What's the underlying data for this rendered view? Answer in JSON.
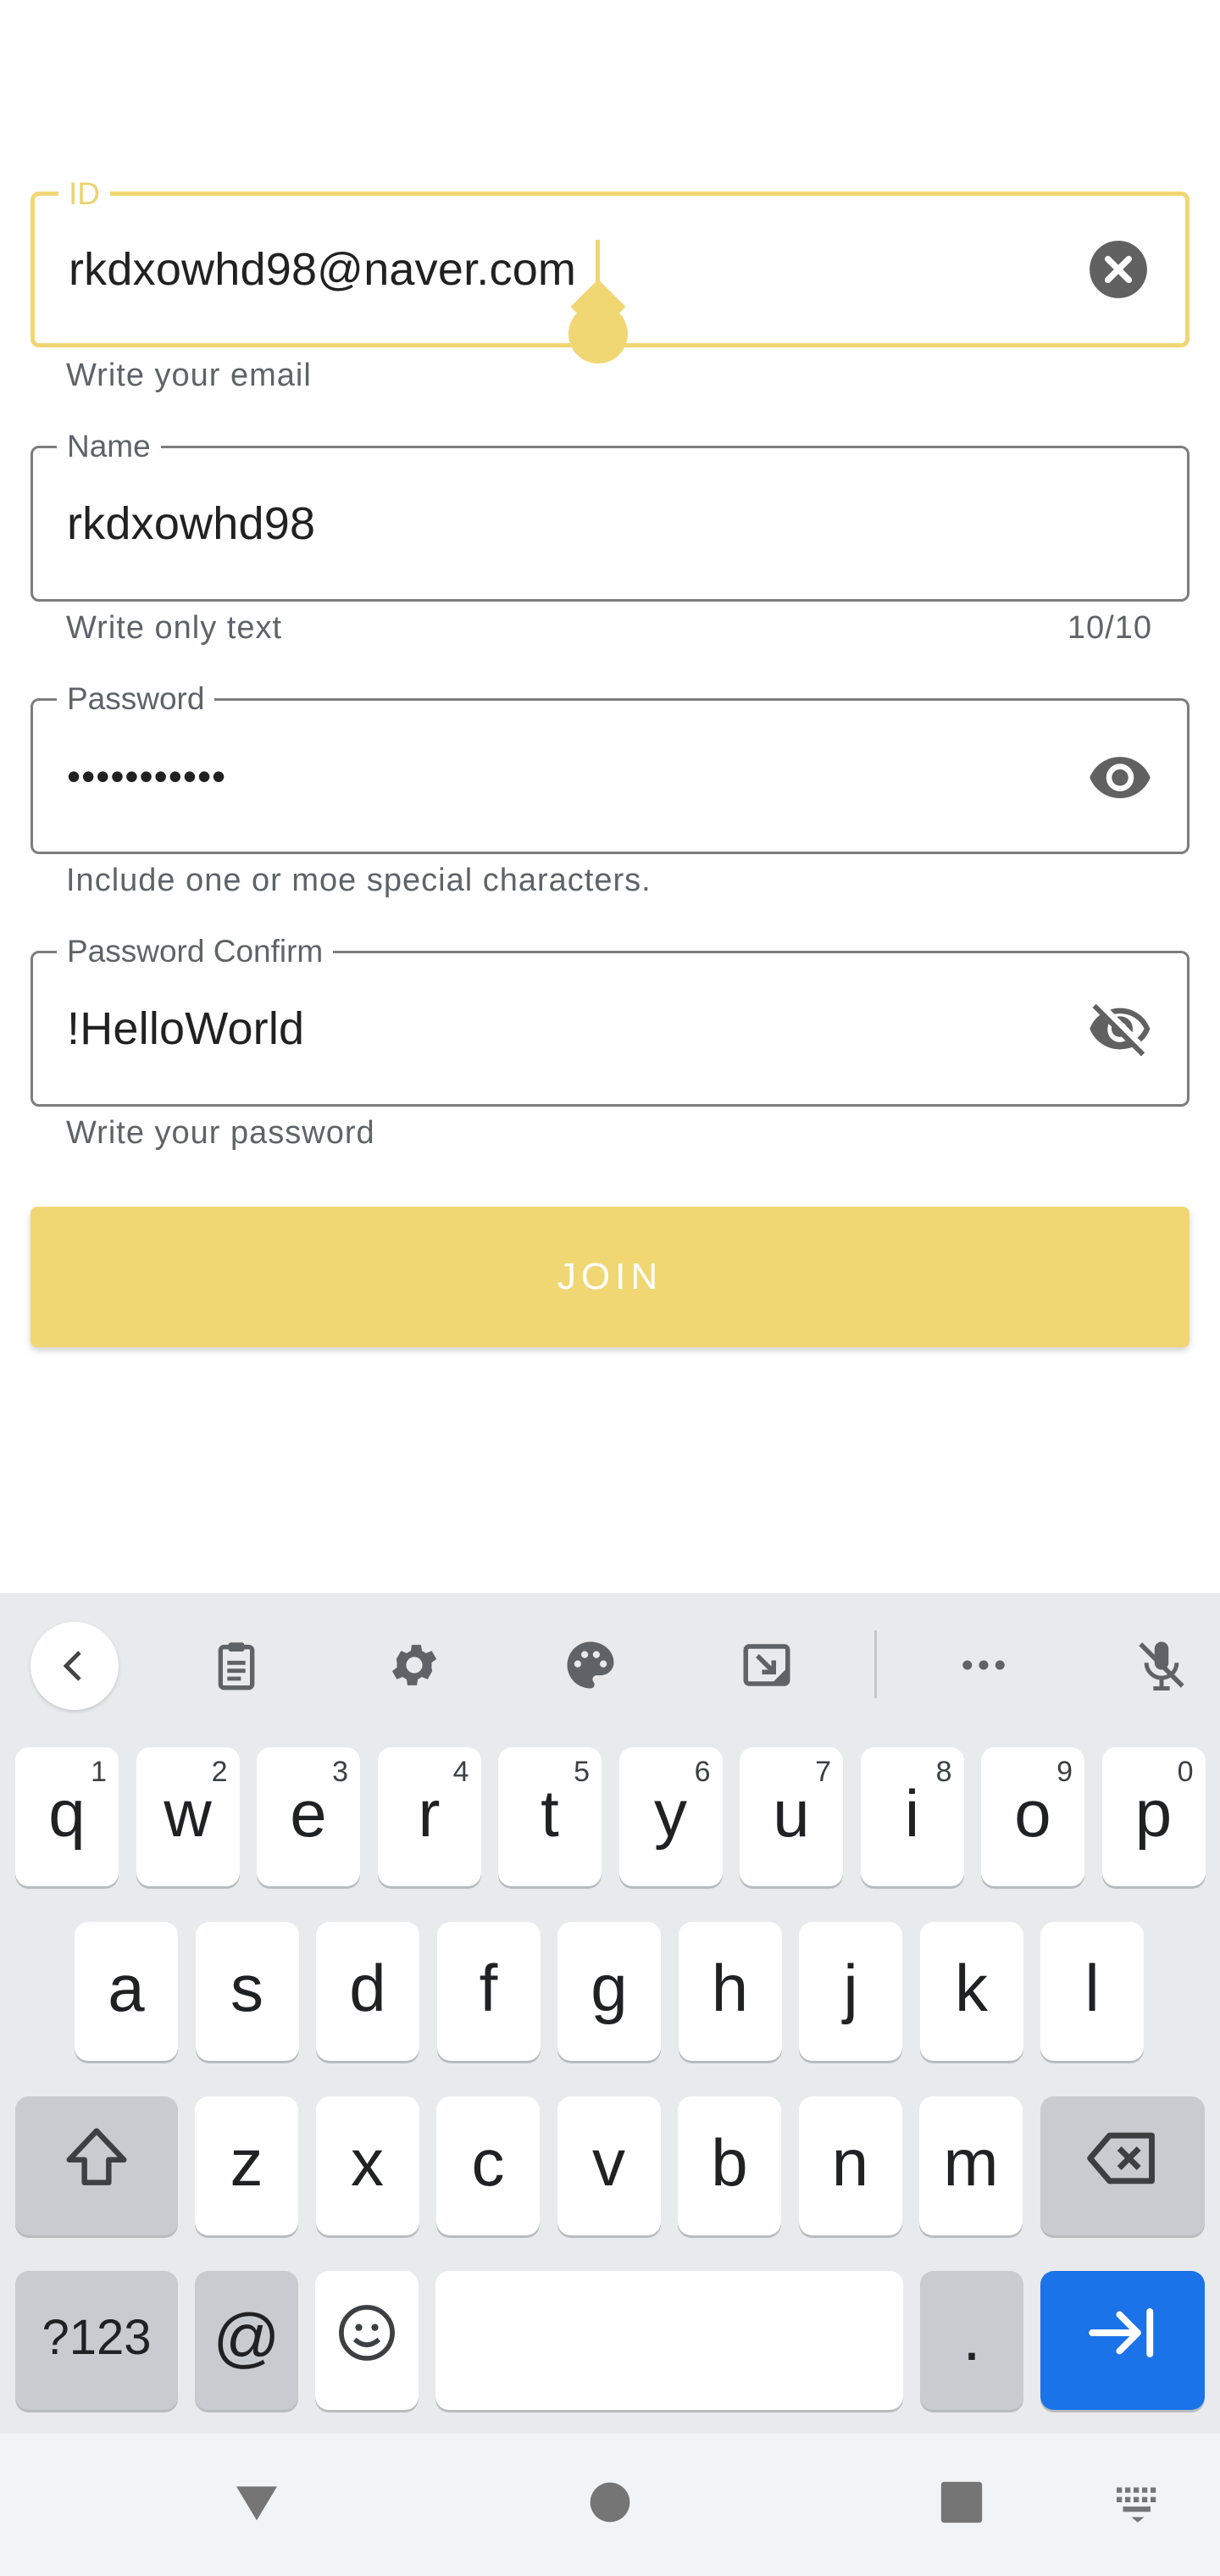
{
  "form": {
    "id_field": {
      "label": "ID",
      "value": "rkdxowhd98@naver.com",
      "helper": "Write your email",
      "clear_icon": "clear-circle-icon"
    },
    "name_field": {
      "label": "Name",
      "value": "rkdxowhd98",
      "helper": "Write only text",
      "counter": "10/10"
    },
    "password_field": {
      "label": "Password",
      "value": "•••••••••••",
      "helper": "Include one or moe special characters.",
      "toggle_icon": "eye-icon"
    },
    "password_confirm_field": {
      "label": "Password Confirm",
      "value": "!HelloWorld",
      "helper": "Write your password",
      "toggle_icon": "eye-off-icon"
    },
    "join_label": "JOIN"
  },
  "colors": {
    "accent": "#f0d774",
    "keyboard_bg": "#e8eaed",
    "enter_key": "#1a73e8"
  },
  "keyboard": {
    "toolbar": [
      "back-icon",
      "clipboard-icon",
      "settings-icon",
      "palette-icon",
      "resize-icon",
      "more-icon",
      "mic-off-icon"
    ],
    "row1": [
      {
        "k": "q",
        "h": "1"
      },
      {
        "k": "w",
        "h": "2"
      },
      {
        "k": "e",
        "h": "3"
      },
      {
        "k": "r",
        "h": "4"
      },
      {
        "k": "t",
        "h": "5"
      },
      {
        "k": "y",
        "h": "6"
      },
      {
        "k": "u",
        "h": "7"
      },
      {
        "k": "i",
        "h": "8"
      },
      {
        "k": "o",
        "h": "9"
      },
      {
        "k": "p",
        "h": "0"
      }
    ],
    "row2": [
      "a",
      "s",
      "d",
      "f",
      "g",
      "h",
      "j",
      "k",
      "l"
    ],
    "row3": [
      "z",
      "x",
      "c",
      "v",
      "b",
      "n",
      "m"
    ],
    "symbols_label": "?123",
    "at_label": "@",
    "period_label": ".",
    "shift_icon": "shift-icon",
    "backspace_icon": "backspace-icon",
    "emoji_icon": "emoji-icon",
    "enter_icon": "tab-next-icon"
  },
  "navbar": [
    "back-triangle-icon",
    "home-circle-icon",
    "recents-square-icon",
    "keyboard-switch-icon"
  ]
}
